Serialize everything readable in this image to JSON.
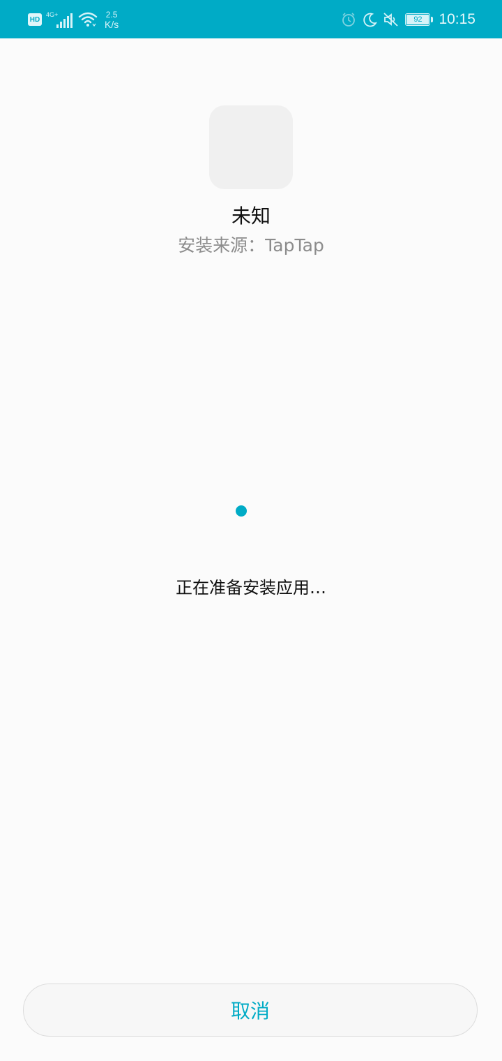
{
  "status_bar": {
    "hd_badge": "HD",
    "network_type": "4G+",
    "net_speed_value": "2.5",
    "net_speed_unit": "K/s",
    "battery_level": "92",
    "battery_fill_fraction": 0.92,
    "time": "10:15",
    "icons": [
      "signal-icon",
      "wifi-icon",
      "alarm-icon",
      "moon-icon",
      "mute-icon",
      "battery-icon"
    ]
  },
  "app": {
    "name": "未知",
    "install_source": "安装来源：TapTap"
  },
  "progress": {
    "message": "正在准备安装应用…"
  },
  "actions": {
    "cancel_label": "取消"
  },
  "colors": {
    "accent": "#00abc6",
    "background": "#fbfbfb"
  }
}
